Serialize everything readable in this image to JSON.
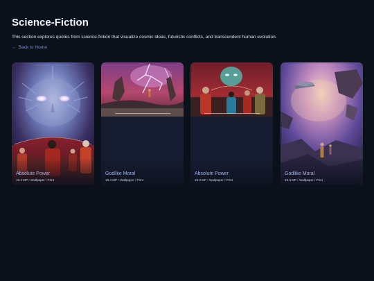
{
  "page": {
    "title": "Science-Fiction",
    "intro": "This section explores quotes from science-fiction that visualize cosmic ideas, futuristic conflicts, and transcendent human evolution.",
    "back_link": {
      "arrow": "←",
      "label": "Back to Home"
    }
  },
  "cards": [
    {
      "title": "Absolute Power",
      "meta": "19.3 MP • Wallpaper / Print",
      "image_icon": "cosmic-face-bridge-image"
    },
    {
      "title": "Godlike Moral",
      "meta": "19.3 MP • Wallpaper / Print",
      "image_icon": "lightning-planet-image"
    },
    {
      "title": "Absolute Power",
      "meta": "19.3 MP • Wallpaper / Print",
      "image_icon": "alien-bridge-image"
    },
    {
      "title": "Godlike Moral",
      "meta": "19.3 MP • Wallpaper / Print",
      "image_icon": "nebula-starship-image"
    }
  ],
  "colors": {
    "background": "#0b111a",
    "card": "#161c30",
    "link": "#6f8fe8",
    "card_title": "#9fb1ee"
  }
}
